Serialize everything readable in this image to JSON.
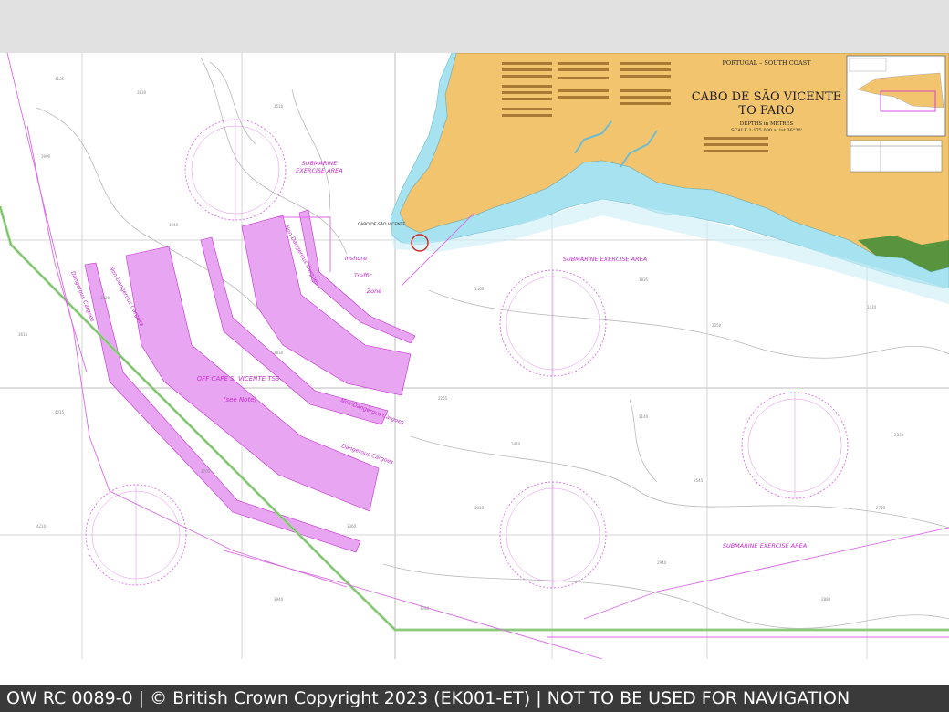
{
  "title_block": {
    "region": "PORTUGAL – SOUTH COAST",
    "title_line1": "CABO DE SÃO VICENTE",
    "title_line2": "TO FARO",
    "depths": "DEPTHS in METRES",
    "scale": "SCALE 1:175 000 at lat 36°30'"
  },
  "labels": {
    "submarine_area_1": "SUBMARINE\nEXERCISE AREA",
    "submarine_area_2": "SUBMARINE EXERCISE AREA",
    "submarine_area_3": "SUBMARINE EXERCISE AREA",
    "tss_name": "OFF CAPE S. VICENTE TSS",
    "tss_note": "(see Note)",
    "inshore": "Inshore",
    "traffic": "Traffic",
    "zone": "Zone",
    "non_dangerous_1": "Non-Dangerous Cargoes",
    "non_dangerous_2": "Non-Dangerous Cargoes",
    "non_dangerous_3": "Non-Dangerous Cargoes",
    "dangerous_1": "Dangerous Cargoes",
    "dangerous_2": "Dangerous Cargoes",
    "cape": "CABO DE SÃO VICENTE"
  },
  "footer": {
    "text": "OW RC 0089-0 | © British Crown Copyright 2023 (EK001-ET) | NOT TO BE USED FOR NAVIGATION"
  },
  "colors": {
    "land": "#f2c46e",
    "shallow": "#a6e2ef",
    "shallow_deep": "#c9eef6",
    "tss": "#e7a5f2",
    "magenta": "#c42bd0",
    "route": "#9fd690",
    "vegetation": "#3c8c35"
  }
}
